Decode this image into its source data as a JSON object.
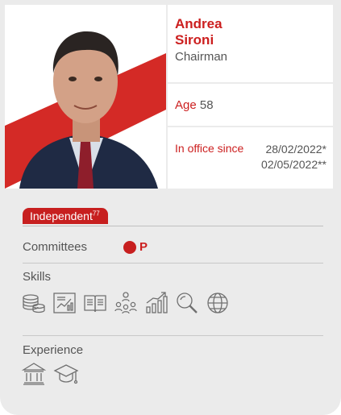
{
  "person": {
    "first_name": "Andrea",
    "last_name": "Sironi",
    "role": "Chairman",
    "age_label": "Age",
    "age_value": "58",
    "office_label": "In office since",
    "office_date_1": "28/02/2022*",
    "office_date_2": "02/05/2022**"
  },
  "badge": {
    "label": "Independent",
    "footnote": "77"
  },
  "committees": {
    "label": "Committees",
    "value": "P"
  },
  "skills": {
    "label": "Skills",
    "icons": [
      "coins-stack-icon",
      "report-chart-icon",
      "open-book-icon",
      "people-network-icon",
      "growth-bars-icon",
      "magnifier-icon",
      "globe-icon"
    ]
  },
  "experience": {
    "label": "Experience",
    "icons": [
      "institution-icon",
      "graduation-cap-icon"
    ]
  },
  "colors": {
    "accent": "#c71f1f",
    "card_bg": "#ebebeb",
    "text_grey": "#555555"
  }
}
